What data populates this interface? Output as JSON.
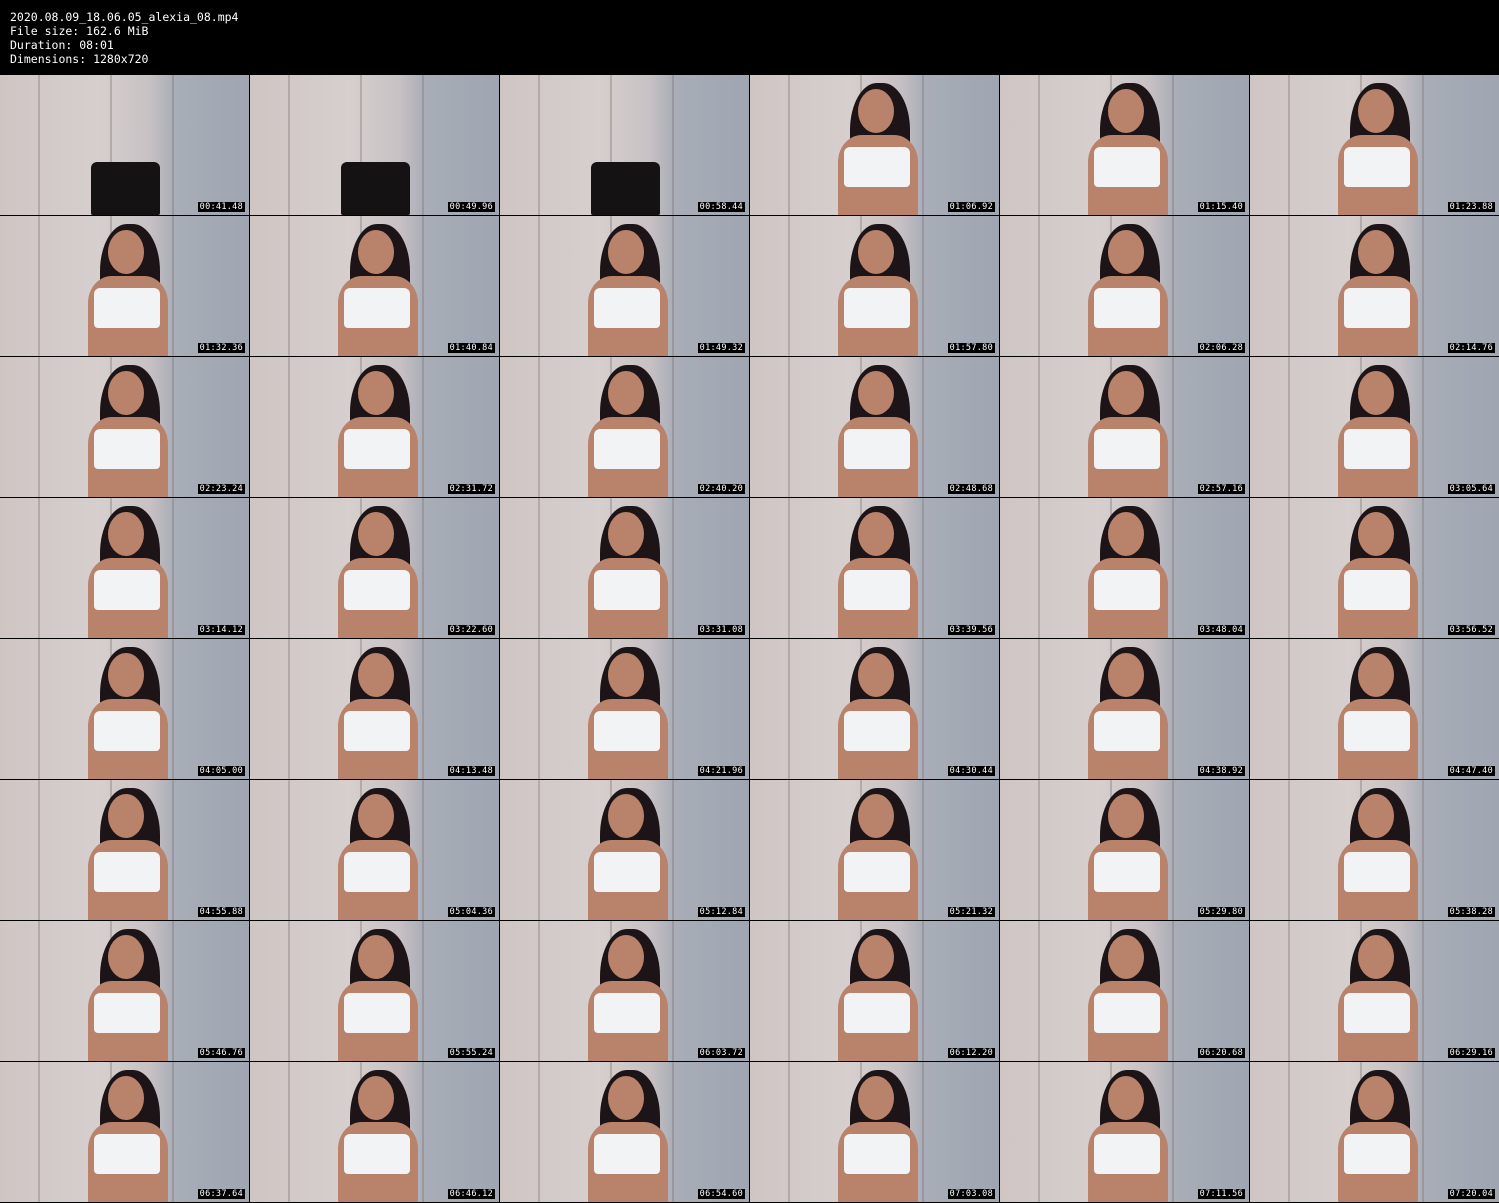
{
  "header": {
    "filename": "2020.08.09_18.06.05_alexia_08.mp4",
    "filesize": "File size: 162.6 MiB",
    "duration": "Duration: 08:01",
    "dimensions": "Dimensions: 1280x720"
  },
  "thumbnails": [
    {
      "ts": "00:41.48",
      "scene": "chair"
    },
    {
      "ts": "00:49.96",
      "scene": "chair"
    },
    {
      "ts": "00:58.44",
      "scene": "chair"
    },
    {
      "ts": "01:06.92",
      "scene": "person"
    },
    {
      "ts": "01:15.40",
      "scene": "person"
    },
    {
      "ts": "01:23.88",
      "scene": "person"
    },
    {
      "ts": "01:32.36",
      "scene": "person"
    },
    {
      "ts": "01:40.84",
      "scene": "person"
    },
    {
      "ts": "01:49.32",
      "scene": "person"
    },
    {
      "ts": "01:57.80",
      "scene": "person"
    },
    {
      "ts": "02:06.28",
      "scene": "person"
    },
    {
      "ts": "02:14.76",
      "scene": "person"
    },
    {
      "ts": "02:23.24",
      "scene": "person"
    },
    {
      "ts": "02:31.72",
      "scene": "person"
    },
    {
      "ts": "02:40.20",
      "scene": "person"
    },
    {
      "ts": "02:48.68",
      "scene": "person"
    },
    {
      "ts": "02:57.16",
      "scene": "person"
    },
    {
      "ts": "03:05.64",
      "scene": "person"
    },
    {
      "ts": "03:14.12",
      "scene": "person"
    },
    {
      "ts": "03:22.60",
      "scene": "person"
    },
    {
      "ts": "03:31.08",
      "scene": "person"
    },
    {
      "ts": "03:39.56",
      "scene": "person"
    },
    {
      "ts": "03:48.04",
      "scene": "person"
    },
    {
      "ts": "03:56.52",
      "scene": "person"
    },
    {
      "ts": "04:05.00",
      "scene": "person"
    },
    {
      "ts": "04:13.48",
      "scene": "person"
    },
    {
      "ts": "04:21.96",
      "scene": "person"
    },
    {
      "ts": "04:30.44",
      "scene": "person"
    },
    {
      "ts": "04:38.92",
      "scene": "person"
    },
    {
      "ts": "04:47.40",
      "scene": "person"
    },
    {
      "ts": "04:55.88",
      "scene": "person"
    },
    {
      "ts": "05:04.36",
      "scene": "person"
    },
    {
      "ts": "05:12.84",
      "scene": "person"
    },
    {
      "ts": "05:21.32",
      "scene": "person"
    },
    {
      "ts": "05:29.80",
      "scene": "person"
    },
    {
      "ts": "05:38.28",
      "scene": "person"
    },
    {
      "ts": "05:46.76",
      "scene": "person"
    },
    {
      "ts": "05:55.24",
      "scene": "person"
    },
    {
      "ts": "06:03.72",
      "scene": "person"
    },
    {
      "ts": "06:12.20",
      "scene": "person"
    },
    {
      "ts": "06:20.68",
      "scene": "person"
    },
    {
      "ts": "06:29.16",
      "scene": "person"
    },
    {
      "ts": "06:37.64",
      "scene": "person"
    },
    {
      "ts": "06:46.12",
      "scene": "person"
    },
    {
      "ts": "06:54.60",
      "scene": "person"
    },
    {
      "ts": "07:03.08",
      "scene": "person"
    },
    {
      "ts": "07:11.56",
      "scene": "person"
    },
    {
      "ts": "07:20.04",
      "scene": "person"
    }
  ]
}
